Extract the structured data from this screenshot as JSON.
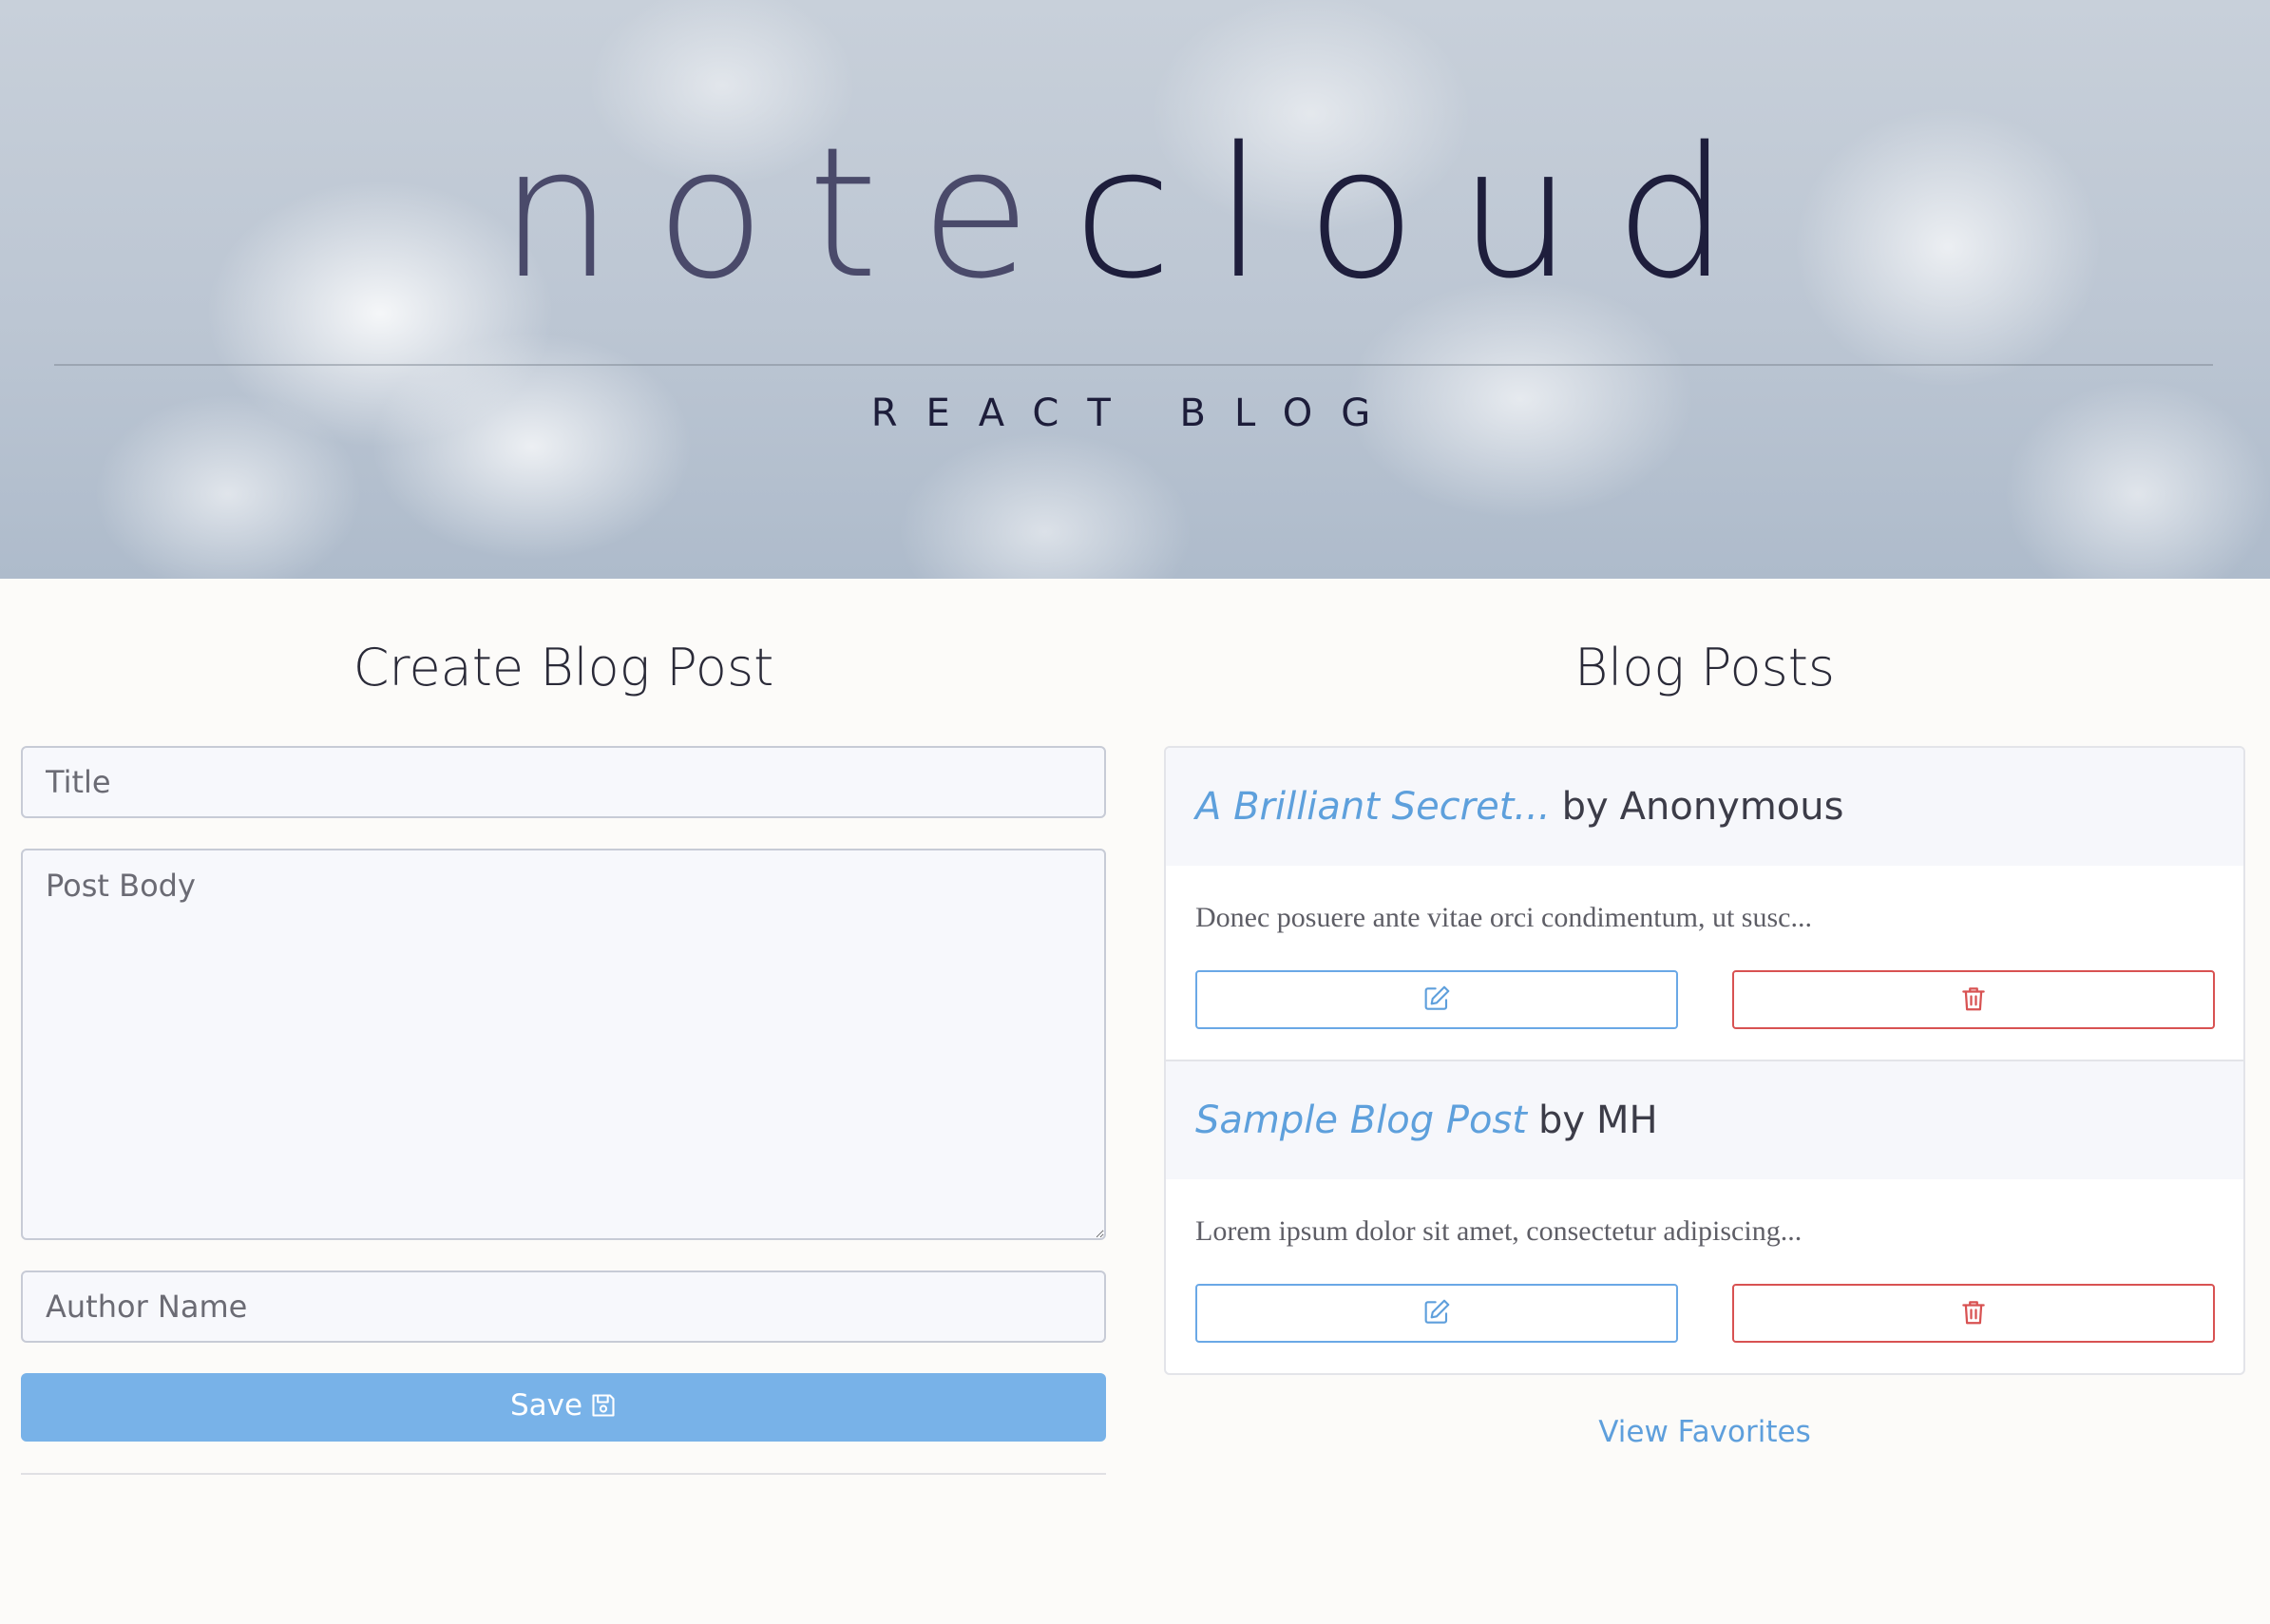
{
  "hero": {
    "title_part1": "note",
    "title_part2": "cloud",
    "subtitle": "REACT BLOG"
  },
  "create": {
    "heading": "Create Blog Post",
    "title_placeholder": "Title",
    "body_placeholder": "Post Body",
    "author_placeholder": "Author Name",
    "save_label": "Save"
  },
  "list": {
    "heading": "Blog Posts",
    "posts": [
      {
        "title": "A Brilliant Secret...",
        "by": "by",
        "author": "Anonymous",
        "excerpt": "Donec posuere ante vitae orci condimentum, ut susc..."
      },
      {
        "title": "Sample Blog Post",
        "by": "by",
        "author": "MH",
        "excerpt": "Lorem ipsum dolor sit amet, consectetur adipiscing..."
      }
    ],
    "view_favorites": "View Favorites"
  },
  "icons": {
    "save": "floppy-disk-icon",
    "edit": "pencil-square-icon",
    "delete": "trash-icon"
  },
  "colors": {
    "accent": "#78b2e8",
    "link": "#5ea0dc",
    "danger": "#d85252",
    "hero_text": "#1e1e3c"
  }
}
